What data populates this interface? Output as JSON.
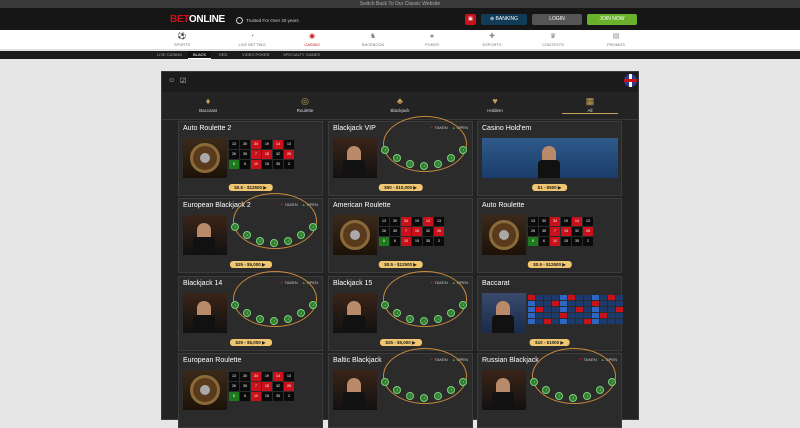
{
  "topbar": {
    "text": "Switch Back To Our Classic Website"
  },
  "header": {
    "logo_bet": "BET",
    "logo_online": "ONLINE",
    "trusted": "Trusted For Over 20 years",
    "banking": "BANKING",
    "login": "LOGIN",
    "join": "JOIN NOW"
  },
  "nav": [
    {
      "label": "SPORTS",
      "icon": "soccer-ball-icon"
    },
    {
      "label": "LIVE BETTING",
      "icon": "live-betting-icon"
    },
    {
      "label": "CASINO",
      "icon": "casino-chip-icon"
    },
    {
      "label": "RACEBOOK",
      "icon": "horse-icon"
    },
    {
      "label": "POKER",
      "icon": "poker-cards-icon"
    },
    {
      "label": "ESPORTS",
      "icon": "gamepad-icon"
    },
    {
      "label": "CONTESTS",
      "icon": "trophy-icon"
    },
    {
      "label": "PROMOS",
      "icon": "gift-icon"
    }
  ],
  "subnav": [
    "LIVE CASINO",
    "BLACK",
    "RED",
    "VIDEO POKER",
    "SPECIALTY GAMES"
  ],
  "categories": [
    {
      "label": "Baccarat",
      "icon": "baccarat-icon"
    },
    {
      "label": "Roulette",
      "icon": "roulette-icon"
    },
    {
      "label": "Blackjack",
      "icon": "blackjack-icon"
    },
    {
      "label": "Holdem",
      "icon": "holdem-icon"
    },
    {
      "label": "All",
      "icon": "grid-icon"
    }
  ],
  "flags": {
    "taken": "TAKEN",
    "open": "OPEN"
  },
  "tiles": [
    {
      "name": "Auto Roulette 2",
      "limit": "$0.5 - $12500",
      "type": "roulette"
    },
    {
      "name": "Blackjack VIP",
      "limit": "$50 - $10,000",
      "type": "blackjack"
    },
    {
      "name": "Casino Hold'em",
      "limit": "$1 - $500",
      "type": "holdem"
    },
    {
      "name": "European Blackjack 2",
      "limit": "$25 - $5,000",
      "type": "blackjack"
    },
    {
      "name": "American Roulette",
      "limit": "$0.5 - $12500",
      "type": "roulette"
    },
    {
      "name": "Auto Roulette",
      "limit": "$0.5 - $12500",
      "type": "roulette"
    },
    {
      "name": "Blackjack 14",
      "limit": "$25 - $5,000",
      "type": "blackjack"
    },
    {
      "name": "Blackjack 15",
      "limit": "$25 - $5,000",
      "type": "blackjack"
    },
    {
      "name": "Baccarat",
      "limit": "$10 - $1000",
      "type": "baccarat"
    },
    {
      "name": "European Roulette",
      "limit": "",
      "type": "roulette"
    },
    {
      "name": "Baltic Blackjack",
      "limit": "",
      "type": "blackjack"
    },
    {
      "name": "Russian Blackjack",
      "limit": "",
      "type": "blackjack"
    }
  ],
  "roulette_numbers": [
    "13",
    "30",
    "34",
    "19",
    "14",
    "13",
    "26",
    "35",
    "7",
    "15",
    "32",
    "26",
    "8",
    "6",
    "10",
    "15",
    "35",
    "2"
  ]
}
